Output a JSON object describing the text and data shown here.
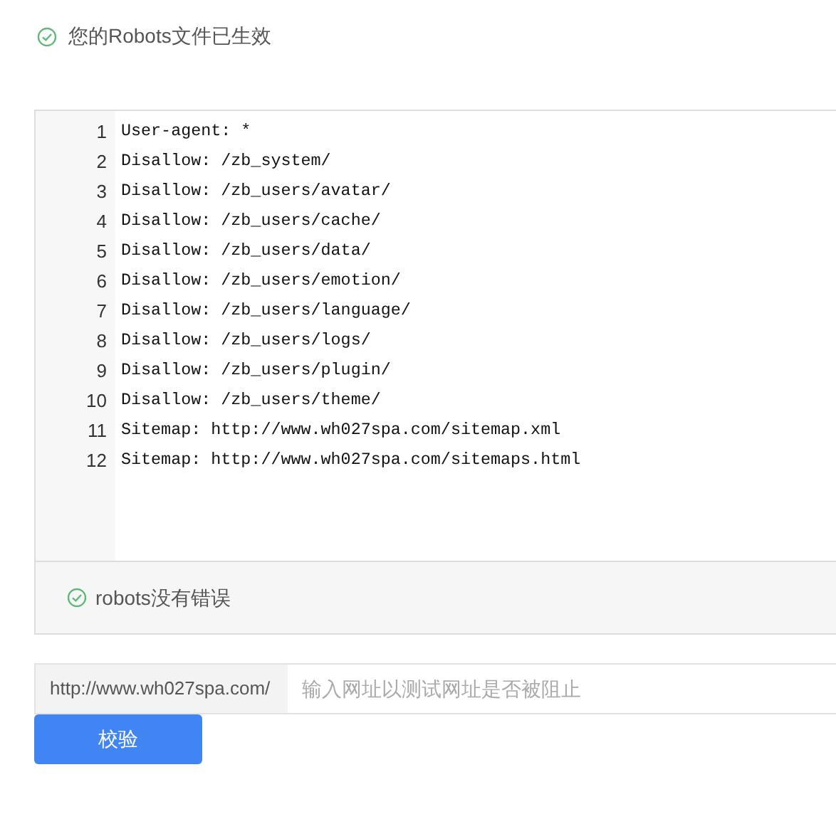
{
  "status": {
    "text": "您的Robots文件已生效"
  },
  "editor": {
    "lines": [
      {
        "number": "1",
        "text": "User-agent: *"
      },
      {
        "number": "2",
        "text": "Disallow: /zb_system/"
      },
      {
        "number": "3",
        "text": "Disallow: /zb_users/avatar/"
      },
      {
        "number": "4",
        "text": "Disallow: /zb_users/cache/"
      },
      {
        "number": "5",
        "text": "Disallow: /zb_users/data/"
      },
      {
        "number": "6",
        "text": "Disallow: /zb_users/emotion/"
      },
      {
        "number": "7",
        "text": "Disallow: /zb_users/language/"
      },
      {
        "number": "8",
        "text": "Disallow: /zb_users/logs/"
      },
      {
        "number": "9",
        "text": "Disallow: /zb_users/plugin/"
      },
      {
        "number": "10",
        "text": "Disallow: /zb_users/theme/"
      },
      {
        "number": "11",
        "text": "Sitemap: http://www.wh027spa.com/sitemap.xml"
      },
      {
        "number": "12",
        "text": "Sitemap: http://www.wh027spa.com/sitemaps.html"
      }
    ]
  },
  "check_result": {
    "text": "robots没有错误"
  },
  "url_test": {
    "prefix": "http://www.wh027spa.com/",
    "placeholder": "输入网址以测试网址是否被阻止"
  },
  "button": {
    "label": "校验"
  }
}
